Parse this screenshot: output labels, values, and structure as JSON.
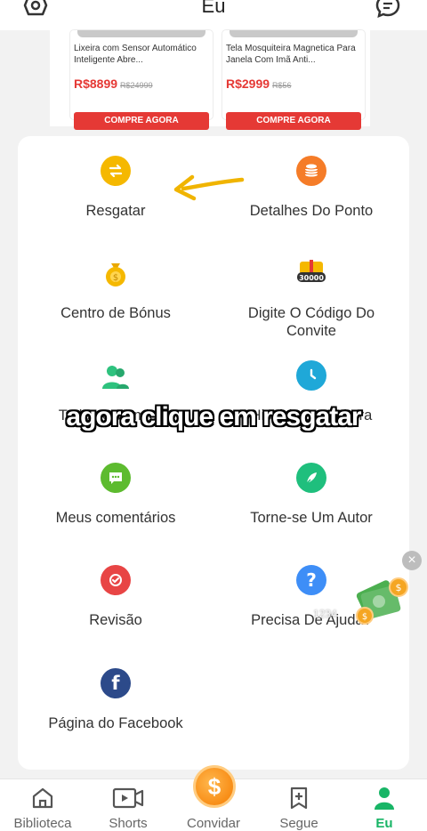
{
  "header": {
    "title": "Eu",
    "left_icon": "settings-icon",
    "right_icon": "message-icon"
  },
  "products": [
    {
      "name": "Lixeira com Sensor Automático Inteligente Abre...",
      "price": "R$8899",
      "old_price": "R$24999",
      "button": "COMPRE AGORA"
    },
    {
      "name": "Tela Mosquiteira Magnetica Para Janela Com Imã Anti...",
      "price": "R$2999",
      "old_price": "R$56",
      "button": "COMPRE AGORA"
    }
  ],
  "menu": [
    {
      "label": "Resgatar",
      "icon": "exchange-icon",
      "color": "#f5b800"
    },
    {
      "label": "Detalhes Do Ponto",
      "icon": "coins-stack-icon",
      "color": "#f57c28"
    },
    {
      "label": "Centro de Bónus",
      "icon": "money-bag-icon",
      "color": "#f5b800"
    },
    {
      "label": "Digite O Código Do Convite",
      "icon": "gift-code-icon",
      "color": "#f5b800",
      "badge": "30000"
    },
    {
      "label": "Todos Os Amigos",
      "icon": "friends-icon",
      "color": "#2ec27e"
    },
    {
      "label": "História De Leitura",
      "icon": "clock-icon",
      "color": "#1fa8d8"
    },
    {
      "label": "Meus comentários",
      "icon": "comment-icon",
      "color": "#5dbb2f"
    },
    {
      "label": "Torne-se Um Autor",
      "icon": "pen-icon",
      "color": "#1fbf7d"
    },
    {
      "label": "Revisão",
      "icon": "review-icon",
      "color": "#e84545"
    },
    {
      "label": "Precisa De Ajuda?",
      "icon": "help-icon",
      "color": "#3e8ef7"
    },
    {
      "label": "Página do Facebook",
      "icon": "facebook-icon",
      "color": "#2c4a8a"
    }
  ],
  "overlay_caption": "agora clique em resgatar",
  "floating_widget": {
    "text": "1234",
    "close": "×"
  },
  "bottom_nav": [
    {
      "label": "Biblioteca",
      "icon": "home-icon"
    },
    {
      "label": "Shorts",
      "icon": "video-icon"
    },
    {
      "label": "Convidar",
      "icon": "coin-icon"
    },
    {
      "label": "Segue",
      "icon": "bookmark-add-icon"
    },
    {
      "label": "Eu",
      "icon": "user-icon",
      "active": true
    }
  ],
  "colors": {
    "accent": "#18b566",
    "price": "#e53935",
    "arrow": "#f0b400"
  }
}
